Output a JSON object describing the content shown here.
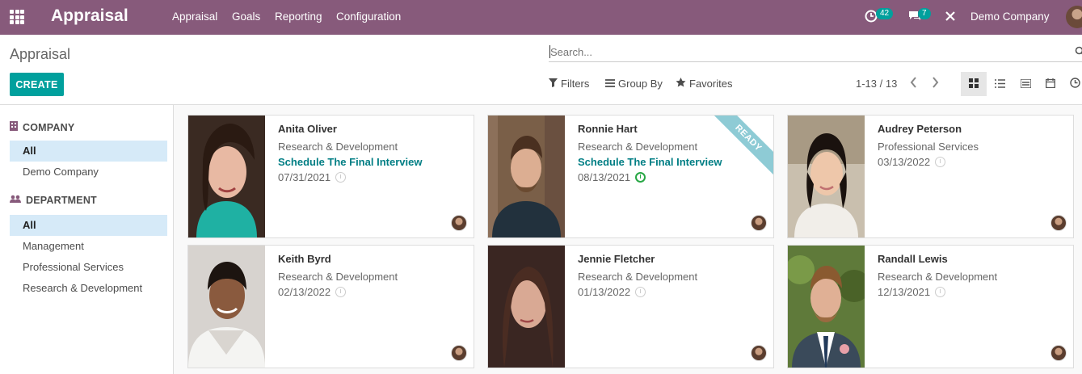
{
  "navbar": {
    "brand": "Appraisal",
    "menus": [
      "Appraisal",
      "Goals",
      "Reporting",
      "Configuration"
    ],
    "activity_count": "42",
    "message_count": "7",
    "company": "Demo Company",
    "color": "#875a7b"
  },
  "control_panel": {
    "breadcrumb": "Appraisal",
    "create_label": "CREATE",
    "search_placeholder": "Search...",
    "filters_label": "Filters",
    "groupby_label": "Group By",
    "favorites_label": "Favorites",
    "pager": "1-13 / 13",
    "views": [
      "kanban-icon",
      "list-icon",
      "form-icon",
      "calendar-icon",
      "activity-icon"
    ]
  },
  "sidebar": {
    "company_title": "COMPANY",
    "company_items": [
      "All",
      "Demo Company"
    ],
    "department_title": "DEPARTMENT",
    "department_items": [
      "All",
      "Management",
      "Professional Services",
      "Research & Development"
    ]
  },
  "cards": [
    {
      "name": "Anita Oliver",
      "dept": "Research & Development",
      "action": "Schedule The Final Interview",
      "date": "07/31/2021",
      "ribbon": ""
    },
    {
      "name": "Ronnie Hart",
      "dept": "Research & Development",
      "action": "Schedule The Final Interview",
      "date": "08/13/2021",
      "ribbon": "READY"
    },
    {
      "name": "Audrey Peterson",
      "dept": "Professional Services",
      "action": "",
      "date": "03/13/2022",
      "ribbon": ""
    },
    {
      "name": "Keith Byrd",
      "dept": "Research & Development",
      "action": "",
      "date": "02/13/2022",
      "ribbon": ""
    },
    {
      "name": "Jennie Fletcher",
      "dept": "Research & Development",
      "action": "",
      "date": "01/13/2022",
      "ribbon": ""
    },
    {
      "name": "Randall Lewis",
      "dept": "Research & Development",
      "action": "",
      "date": "12/13/2021",
      "ribbon": ""
    }
  ],
  "colors": {
    "accent": "#00a09d",
    "link": "#017e84",
    "selected_bg": "#d6eaf8"
  }
}
